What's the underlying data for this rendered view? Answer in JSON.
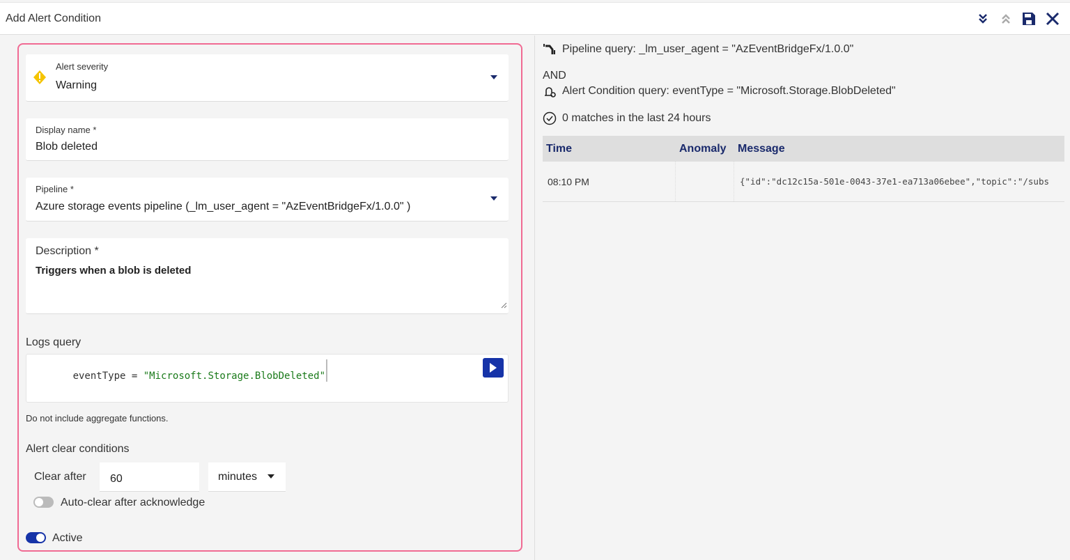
{
  "header": {
    "title": "Add Alert Condition",
    "icons": [
      "chevron-double-down-icon",
      "chevron-double-up-icon",
      "save-icon",
      "close-icon"
    ]
  },
  "form": {
    "severity": {
      "label": "Alert severity",
      "value": "Warning",
      "icon": "warning-diamond-icon",
      "icon_color": "#f5c400"
    },
    "display_name": {
      "label": "Display name *",
      "value": "Blob deleted"
    },
    "pipeline": {
      "label": "Pipeline *",
      "value": "Azure storage events pipeline (_lm_user_agent = \"AzEventBridgeFx/1.0.0\" )"
    },
    "description": {
      "label": "Description *",
      "value": "Triggers when a blob is deleted"
    },
    "logs_query": {
      "label": "Logs query",
      "field": "eventType",
      "operator": "=",
      "string": "\"Microsoft.Storage.BlobDeleted\"",
      "hint": "Do not include aggregate functions."
    },
    "clear": {
      "heading": "Alert clear conditions",
      "clear_after_label": "Clear after",
      "clear_after_value": "60",
      "unit": "minutes",
      "auto_clear_label": "Auto-clear after acknowledge",
      "auto_clear_on": false
    },
    "active": {
      "label": "Active",
      "on": true
    },
    "accent": "#1633a8",
    "border_color": "#f06a93"
  },
  "preview": {
    "pipeline_query": "Pipeline query: _lm_user_agent = \"AzEventBridgeFx/1.0.0\"",
    "and": "AND",
    "condition_query": "Alert Condition query: eventType = \"Microsoft.Storage.BlobDeleted\"",
    "matches": "0 matches in the last 24 hours",
    "columns": [
      "Time",
      "Anomaly",
      "Message"
    ],
    "rows": [
      {
        "time": "08:10 PM",
        "anomaly": "",
        "message": "{\"id\":\"dc12c15a-501e-0043-37e1-ea713a06ebee\",\"topic\":\"/subs"
      }
    ]
  }
}
